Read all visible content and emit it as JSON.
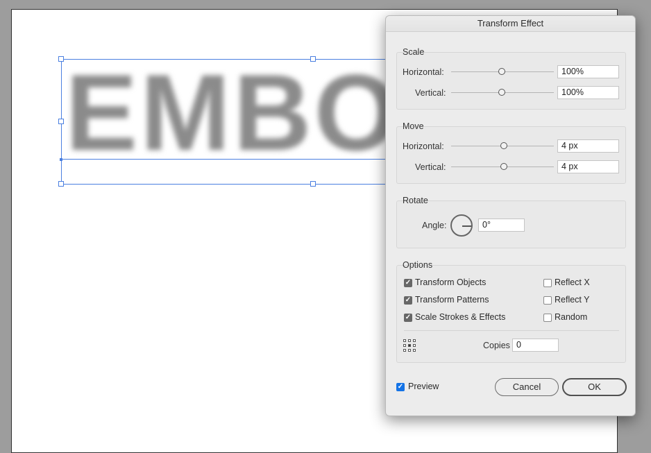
{
  "canvas": {
    "text": "EMBOSS"
  },
  "dialog": {
    "title": "Transform Effect",
    "scale": {
      "label": "Scale",
      "horizontal": {
        "label": "Horizontal:",
        "value": "100%"
      },
      "vertical": {
        "label": "Vertical:",
        "value": "100%"
      }
    },
    "move": {
      "label": "Move",
      "horizontal": {
        "label": "Horizontal:",
        "value": "4 px"
      },
      "vertical": {
        "label": "Vertical:",
        "value": "4 px"
      }
    },
    "rotate": {
      "label": "Rotate",
      "angle_label": "Angle:",
      "angle_value": "0°"
    },
    "options": {
      "label": "Options",
      "transform_objects": "Transform Objects",
      "transform_patterns": "Transform Patterns",
      "scale_strokes": "Scale Strokes & Effects",
      "reflect_x": "Reflect X",
      "reflect_y": "Reflect Y",
      "random": "Random",
      "copies_label": "Copies",
      "copies_value": "0"
    },
    "preview_label": "Preview",
    "cancel_label": "Cancel",
    "ok_label": "OK"
  }
}
